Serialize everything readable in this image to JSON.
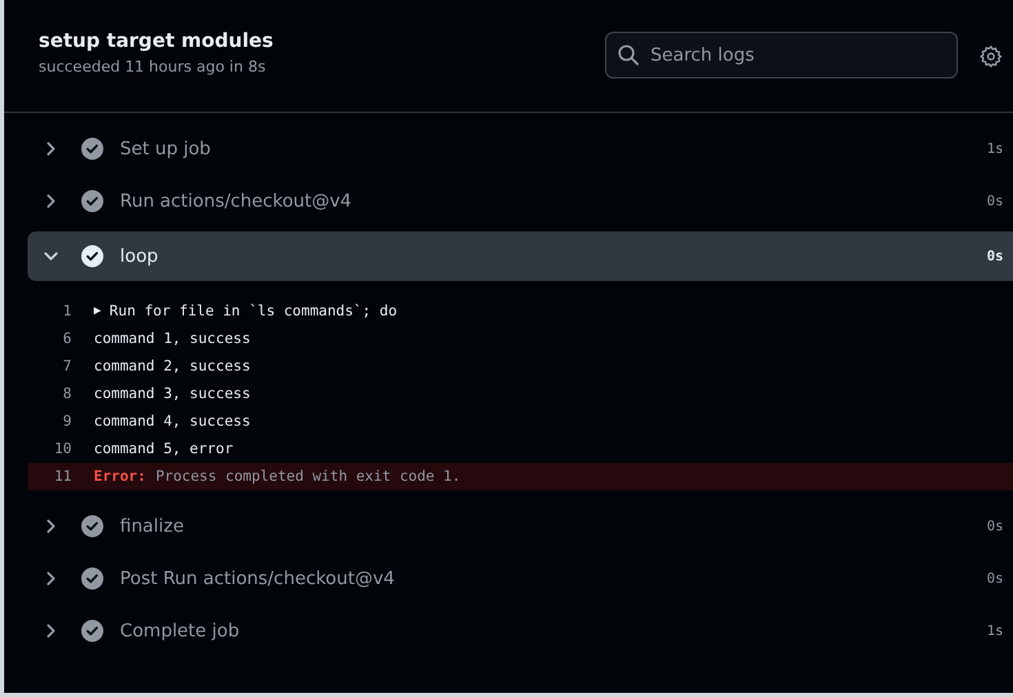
{
  "job": {
    "title": "setup target modules",
    "summary": "succeeded 11 hours ago in 8s"
  },
  "search": {
    "placeholder": "Search logs"
  },
  "steps": [
    {
      "name": "Set up job",
      "duration": "1s",
      "expanded": false
    },
    {
      "name": "Run actions/checkout@v4",
      "duration": "0s",
      "expanded": false
    },
    {
      "name": "loop",
      "duration": "0s",
      "expanded": true,
      "log": [
        {
          "kind": "group",
          "number": "1",
          "marker": "▶",
          "text": "Run for file in `ls commands`; do"
        },
        {
          "kind": "plain",
          "number": "6",
          "text": "command 1, success"
        },
        {
          "kind": "plain",
          "number": "7",
          "text": "command 2, success"
        },
        {
          "kind": "plain",
          "number": "8",
          "text": "command 3, success"
        },
        {
          "kind": "plain",
          "number": "9",
          "text": "command 4, success"
        },
        {
          "kind": "plain",
          "number": "10",
          "text": "command 5, error"
        },
        {
          "kind": "error",
          "number": "11",
          "prefix": "Error:",
          "text": "Process completed with exit code 1."
        }
      ]
    },
    {
      "name": "finalize",
      "duration": "0s",
      "expanded": false
    },
    {
      "name": "Post Run actions/checkout@v4",
      "duration": "0s",
      "expanded": false
    },
    {
      "name": "Complete job",
      "duration": "1s",
      "expanded": false
    }
  ]
}
